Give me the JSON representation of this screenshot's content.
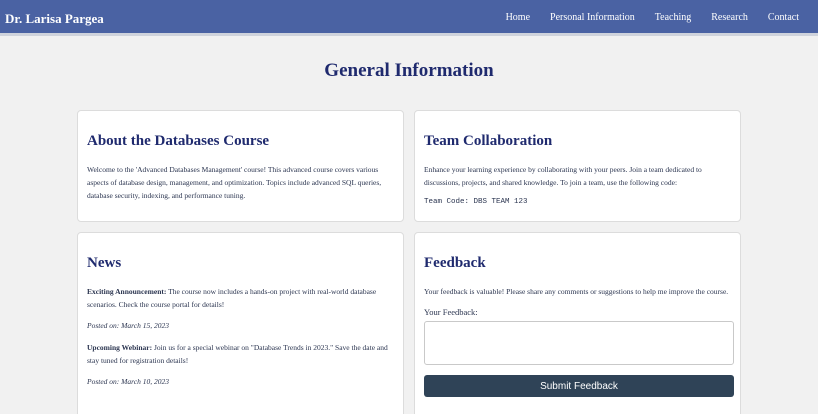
{
  "header": {
    "brand": "Dr. Larisa Pargea",
    "nav": [
      "Home",
      "Personal Information",
      "Teaching",
      "Research",
      "Contact"
    ]
  },
  "main": {
    "title": "General Information"
  },
  "about": {
    "title": "About the Databases Course",
    "text": "Welcome to the 'Advanced Databases Management' course! This advanced course covers various aspects of database design, management, and optimization. Topics include advanced SQL queries, database security, indexing, and performance tuning."
  },
  "team": {
    "title": "Team Collaboration",
    "text": "Enhance your learning experience by collaborating with your peers. Join a team dedicated to discussions, projects, and shared knowledge. To join a team, use the following code:",
    "code": "Team Code: DBS TEAM 123"
  },
  "news": {
    "title": "News",
    "items": [
      {
        "heading": "Exciting Announcement:",
        "text": " The course now includes a hands-on project with real-world database scenarios. Check the course portal for details!",
        "posted": "Posted on: March 15, 2023"
      },
      {
        "heading": "Upcoming Webinar:",
        "text": " Join us for a special webinar on \"Database Trends in 2023.\" Save the date and stay tuned for registration details!",
        "posted": "Posted on: March 10, 2023"
      }
    ]
  },
  "feedback": {
    "title": "Feedback",
    "text": "Your feedback is valuable! Please share any comments or suggestions to help me improve the course.",
    "label": "Your Feedback:",
    "placeholder": "",
    "submit_label": "Submit Feedback"
  },
  "colors": {
    "header_bg": "#4a62a3",
    "title": "#1f2a6e",
    "button_bg": "#2f4357",
    "page_bg": "#f1f1f1"
  }
}
